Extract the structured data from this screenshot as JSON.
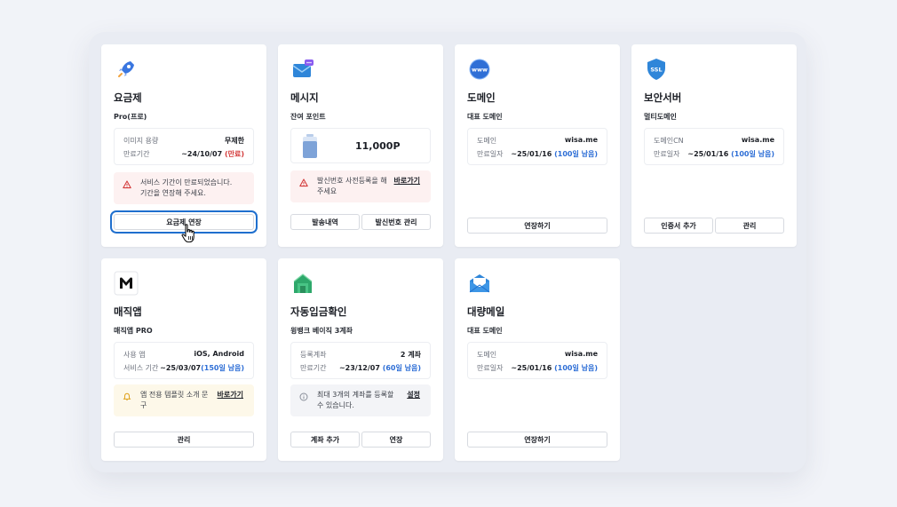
{
  "colors": {
    "accent": "#2f6fd6",
    "danger": "#d33a3a",
    "focus": "#1f6fce"
  },
  "cards": {
    "plan": {
      "icon": "rocket-icon",
      "title": "요금제",
      "subtitle": "Pro(프로)",
      "rows": [
        {
          "label": "이미지 용량",
          "value": "무제한"
        },
        {
          "label": "만료기간",
          "value": "~24/10/07",
          "status": "(만료)"
        }
      ],
      "alert": {
        "line1": "서비스 기간이 만료되었습니다.",
        "line2": "기간을 연장해 주세요."
      },
      "buttons": [
        "요금제 연장"
      ]
    },
    "message": {
      "icon": "message-icon",
      "title": "메시지",
      "subtitle": "잔여 포인트",
      "points": "11,000P",
      "alert": {
        "line1": "발신번호 사전등록을 해",
        "line2": "주세요",
        "link": "바로가기"
      },
      "buttons": [
        "발송내역",
        "발신번호 관리"
      ]
    },
    "domain": {
      "icon": "www-globe-icon",
      "title": "도메인",
      "subtitle": "대표 도메인",
      "rows": [
        {
          "label": "도메인",
          "value": "wisa.me"
        },
        {
          "label": "만료일자",
          "value": "~25/01/16",
          "status": "(100일 남음)"
        }
      ],
      "buttons": [
        "연장하기"
      ]
    },
    "ssl": {
      "icon": "ssl-shield-icon",
      "title": "보안서버",
      "subtitle": "멀티도메인",
      "rows": [
        {
          "label": "도메인CN",
          "value": "wisa.me"
        },
        {
          "label": "만료일자",
          "value": "~25/01/16",
          "status": "(100일 남음)"
        }
      ],
      "buttons": [
        "인증서 추가",
        "관리"
      ]
    },
    "magicapp": {
      "icon": "magicapp-m-icon",
      "title": "매직앱",
      "subtitle": "매직앱 PRO",
      "rows": [
        {
          "label": "사용 앱",
          "value": "iOS, Android"
        },
        {
          "label": "서비스 기간",
          "value": "~25/03/07",
          "status": "(150일 남음)"
        }
      ],
      "alert": {
        "line1": "앱 전용 템플릿 소개 문",
        "line2": "구",
        "link": "바로가기"
      },
      "buttons": [
        "관리"
      ]
    },
    "deposit": {
      "icon": "bank-icon",
      "title": "자동입금확인",
      "subtitle": "윙뱅크 베이직 3계좌",
      "rows": [
        {
          "label": "등록계좌",
          "value": "2 계좌"
        },
        {
          "label": "만료기간",
          "value": "~23/12/07",
          "status": "(60일 남음)"
        }
      ],
      "alert": {
        "line1": "최대 3개의 계좌를 등록할",
        "line2": "수 있습니다.",
        "link": "설정"
      },
      "buttons": [
        "계좌 추가",
        "연장"
      ]
    },
    "bulkmail": {
      "icon": "envelope-icon",
      "title": "대량메일",
      "subtitle": "대표 도메인",
      "rows": [
        {
          "label": "도메인",
          "value": "wisa.me"
        },
        {
          "label": "만료일자",
          "value": "~25/01/16",
          "status": "(100일 남음)"
        }
      ],
      "buttons": [
        "연장하기"
      ]
    }
  }
}
